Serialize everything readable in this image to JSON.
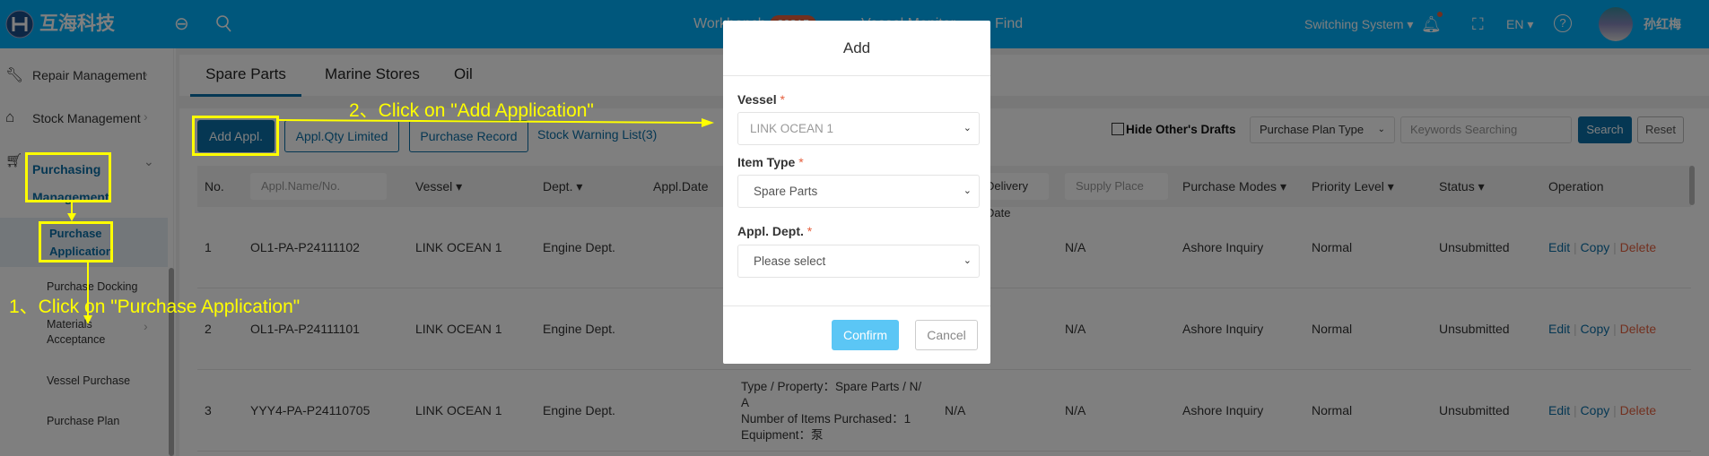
{
  "header": {
    "brand": "互海科技",
    "nav": [
      {
        "label": "Workbench",
        "badge": "20815"
      },
      {
        "label": "Vessel Monitor"
      },
      {
        "label": "Find"
      }
    ],
    "switching": "Switching System",
    "lang": "EN",
    "user": "孙红梅",
    "colors": {
      "bar": "#00aef8",
      "badge": "#e5603f"
    }
  },
  "sidebar": {
    "items": [
      {
        "label": "Repair Management",
        "icon": "wrench-icon"
      },
      {
        "label": "Stock Management",
        "icon": "home-icon"
      },
      {
        "label": "Purchasing Management",
        "line1": "Purchasing",
        "line2": "Management",
        "icon": "cart-icon"
      }
    ],
    "sub": [
      {
        "label": "Purchase Application",
        "line1": "Purchase",
        "line2": "Application"
      },
      {
        "label": "Purchase Docking"
      },
      {
        "label": "Materials Acceptance",
        "line1": "Materials",
        "line2": "Acceptance"
      },
      {
        "label": "Vessel Purchase"
      },
      {
        "label": "Purchase Plan"
      }
    ]
  },
  "tabs": [
    "Spare Parts",
    "Marine Stores",
    "Oil"
  ],
  "toolbar": {
    "add": "Add Appl.",
    "qty": "Appl.Qty Limited",
    "record": "Purchase Record",
    "warning": "Stock Warning List(3)",
    "hide_drafts": "Hide Other's Drafts",
    "plan_type": "Purchase Plan Type",
    "keywords_placeholder": "Keywords Searching",
    "search": "Search",
    "reset": "Reset"
  },
  "table": {
    "headers": {
      "no": "No.",
      "name_placeholder": "Appl.Name/No.",
      "vessel": "Vessel",
      "dept": "Dept.",
      "date": "Appl.Date",
      "delivery": "Delivery Date",
      "supply": "Supply Place",
      "modes": "Purchase Modes",
      "priority": "Priority Level",
      "status": "Status",
      "operation": "Operation"
    },
    "rows": [
      {
        "no": "1",
        "name": "OL1-PA-P24111102",
        "vessel": "LINK OCEAN 1",
        "dept": "Engine Dept.",
        "supply": "N/A",
        "modes": "Ashore Inquiry",
        "priority": "Normal",
        "status": "Unsubmitted"
      },
      {
        "no": "2",
        "name": "OL1-PA-P24111101",
        "vessel": "LINK OCEAN 1",
        "dept": "Engine Dept.",
        "supply": "N/A",
        "modes": "Ashore Inquiry",
        "priority": "Normal",
        "status": "Unsubmitted"
      },
      {
        "no": "3",
        "name": "YYY4-PA-P24110705",
        "vessel": "LINK OCEAN 1",
        "dept": "Engine Dept.",
        "type1": "Type / Property：Spare Parts / N/",
        "type2": "A",
        "type3": "Number of Items Purchased：1",
        "type4": "Equipment：泵",
        "delivery": "N/A",
        "supply": "N/A",
        "modes": "Ashore Inquiry",
        "priority": "Normal",
        "status": "Unsubmitted"
      }
    ],
    "ops": {
      "edit": "Edit",
      "copy": "Copy",
      "delete": "Delete"
    }
  },
  "modal": {
    "title": "Add",
    "vessel_label": "Vessel",
    "vessel_value": "LINK OCEAN 1",
    "type_label": "Item Type",
    "type_value": "Spare Parts",
    "dept_label": "Appl. Dept.",
    "dept_value": "Please select",
    "required": "*",
    "confirm": "Confirm",
    "cancel": "Cancel"
  },
  "annotations": {
    "step1": "1、Click on \"Purchase Application\"",
    "step2": "2、Click on \"Add Application\""
  }
}
